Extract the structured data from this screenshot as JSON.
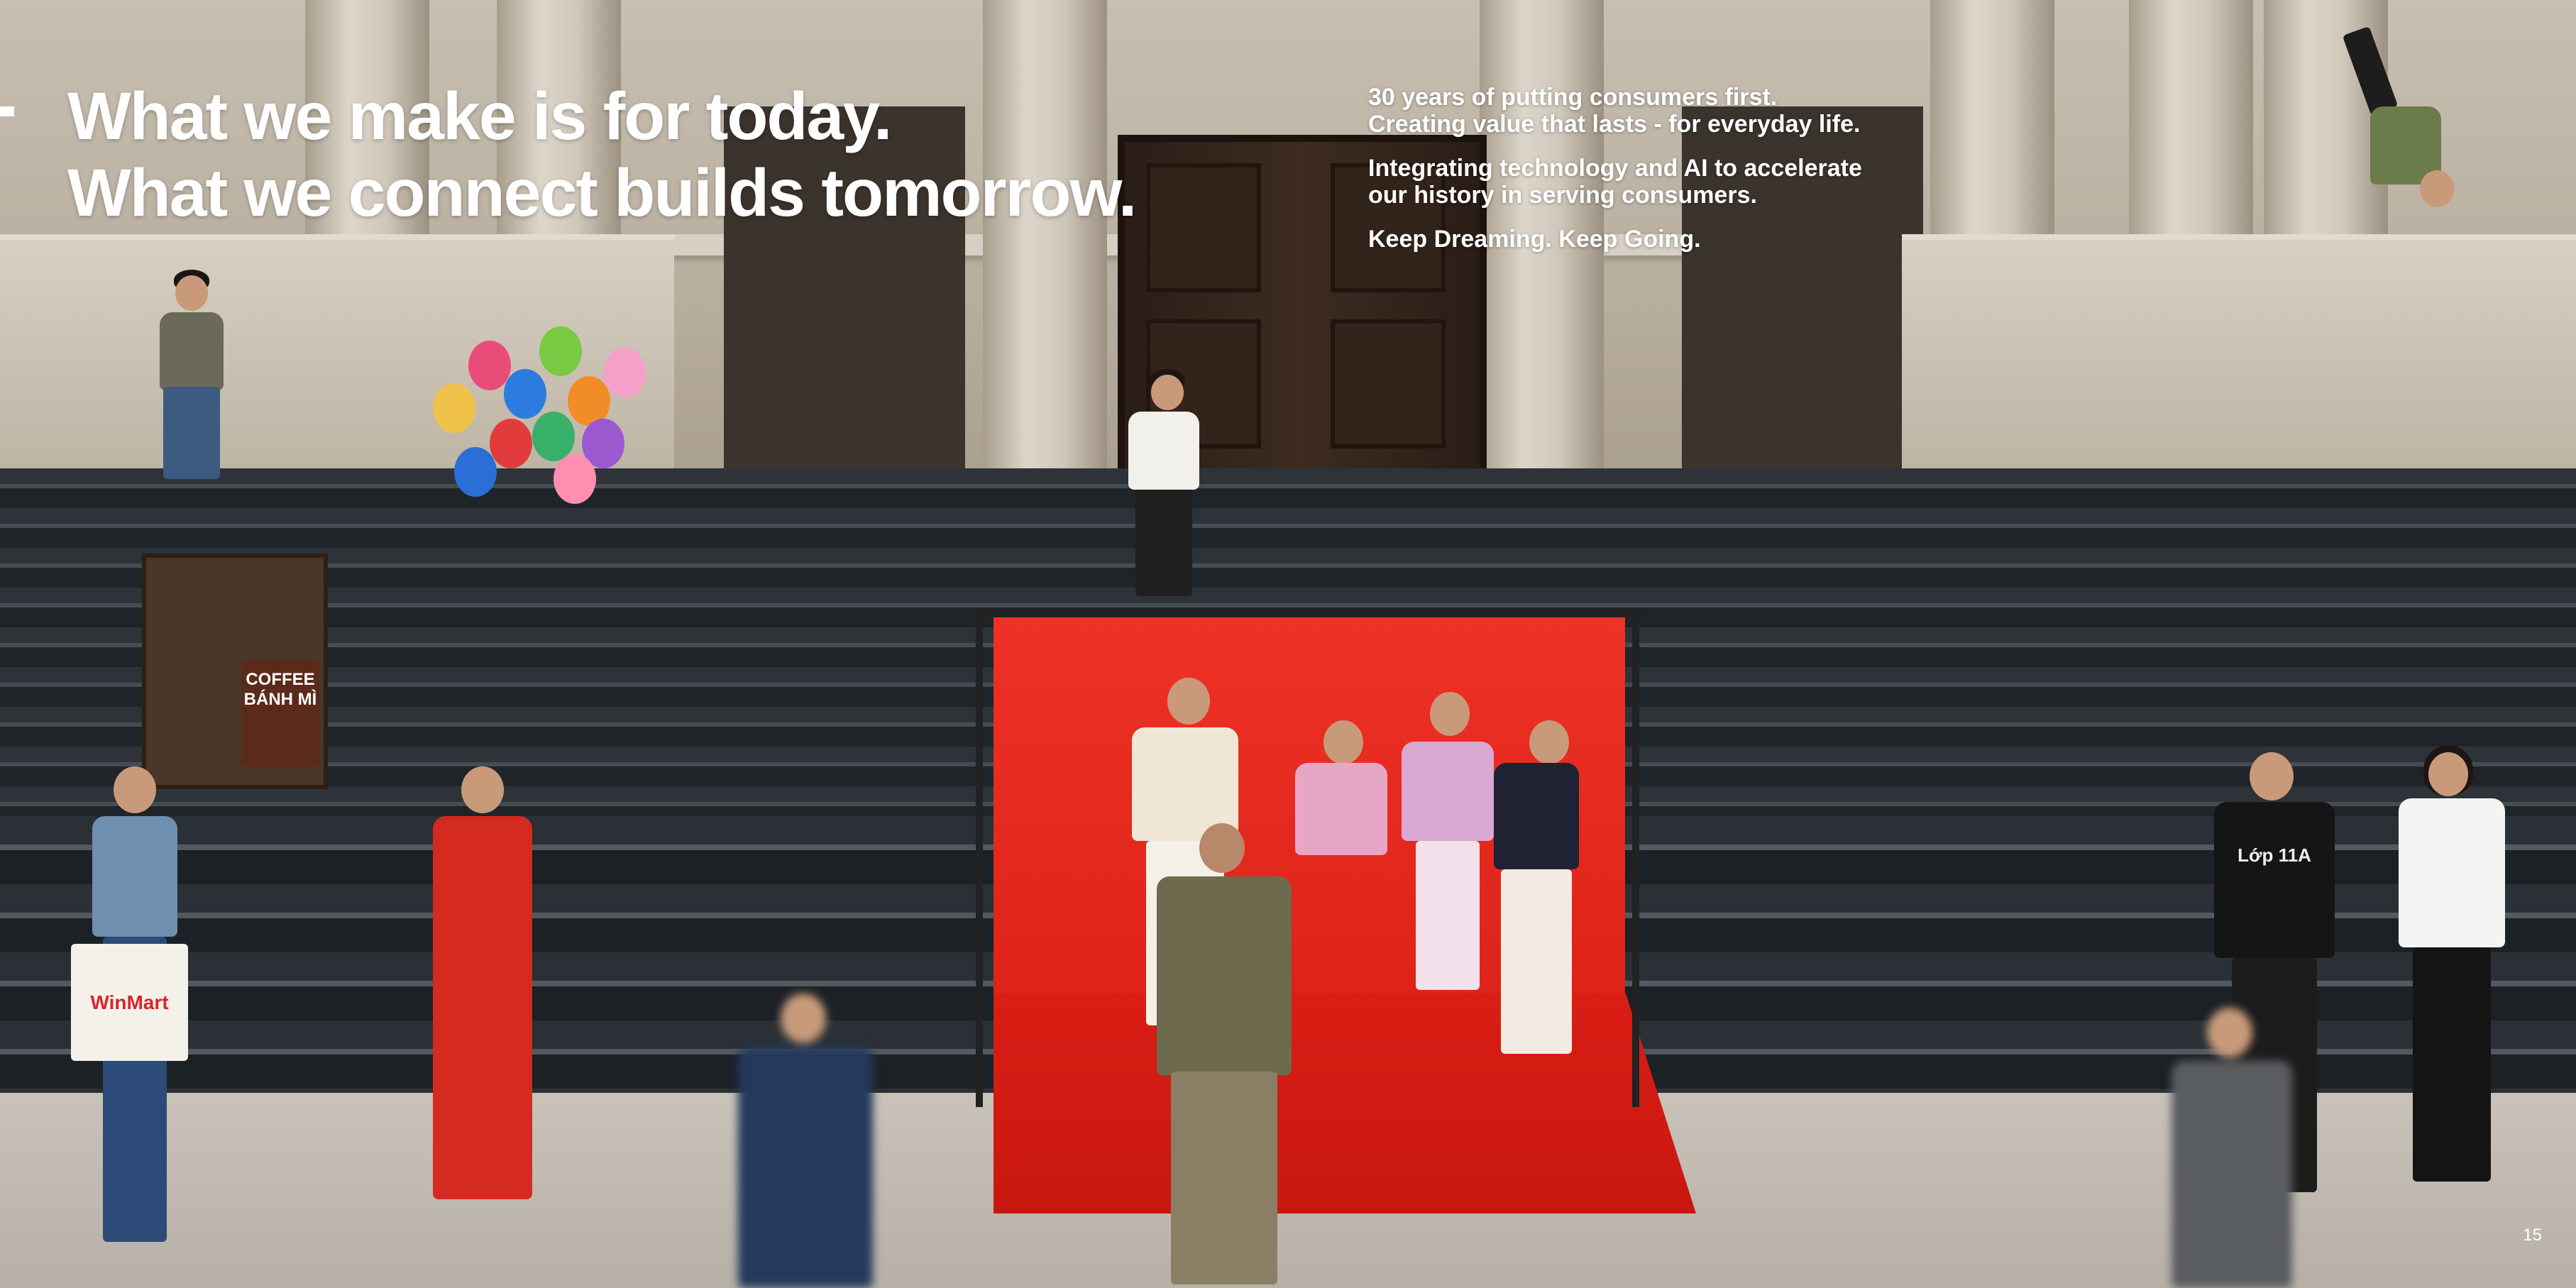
{
  "headline": {
    "line1": "What we make is for today.",
    "line2": "What we connect builds tomorrow."
  },
  "body_copy": {
    "paragraph1": {
      "line1": "30 years of putting consumers first.",
      "line2": "Creating value that lasts - for everyday life."
    },
    "paragraph2": {
      "line1": "Integrating technology and AI to accelerate",
      "line2": "our history in serving consumers."
    },
    "paragraph3": "Keep Dreaming. Keep Going."
  },
  "photo_signage": {
    "cart_sign": "COFFEE BÁNH MÌ",
    "shopping_bag": "WinMart",
    "tshirt_print": "Lớp 11A"
  },
  "page_number": "15",
  "colors": {
    "text": "#ffffff",
    "backdrop_red": "#e0261c",
    "stairs": "#2d3338",
    "stone": "#c7bfb2"
  }
}
